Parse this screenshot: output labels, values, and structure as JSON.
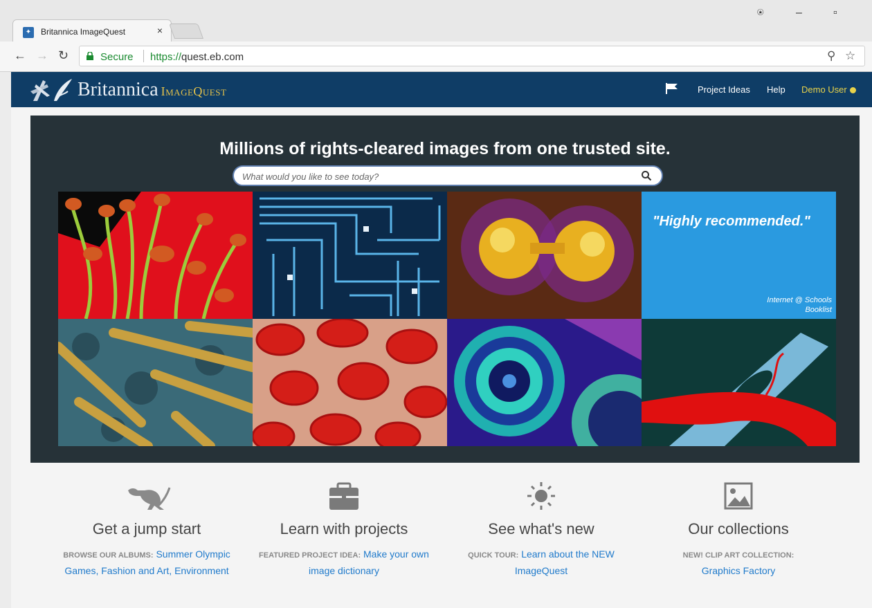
{
  "browser": {
    "tab_title": "Britannica ImageQuest",
    "tab_close": "×",
    "secure_label": "Secure",
    "url_scheme": "https://",
    "url_host": "quest.eb.com"
  },
  "header": {
    "logo_main": "Britannica",
    "logo_sub": "ImageQuest",
    "nav": [
      {
        "label": "Project Ideas"
      },
      {
        "label": "Help"
      },
      {
        "label": "Demo User"
      }
    ]
  },
  "hero": {
    "title": "Millions of rights-cleared images from one trusted site.",
    "search_placeholder": "What would you like to see today?",
    "quote": "\"Highly recommended.\"",
    "quote_source": "Internet @ Schools\nBooklist"
  },
  "features": [
    {
      "icon": "kangaroo-icon",
      "title": "Get a jump start",
      "label": "BROWSE OUR ALBUMS:",
      "link": "Summer Olympic Games, Fashion and Art, Environment"
    },
    {
      "icon": "briefcase-icon",
      "title": "Learn with projects",
      "label": "FEATURED PROJECT IDEA:",
      "link": "Make your own image dictionary"
    },
    {
      "icon": "sun-icon",
      "title": "See what's new",
      "label": "QUICK TOUR:",
      "link": "Learn about the NEW ImageQuest"
    },
    {
      "icon": "image-icon",
      "title": "Our collections",
      "label": "NEW! CLIP ART COLLECTION:",
      "link": "Graphics Factory"
    }
  ]
}
